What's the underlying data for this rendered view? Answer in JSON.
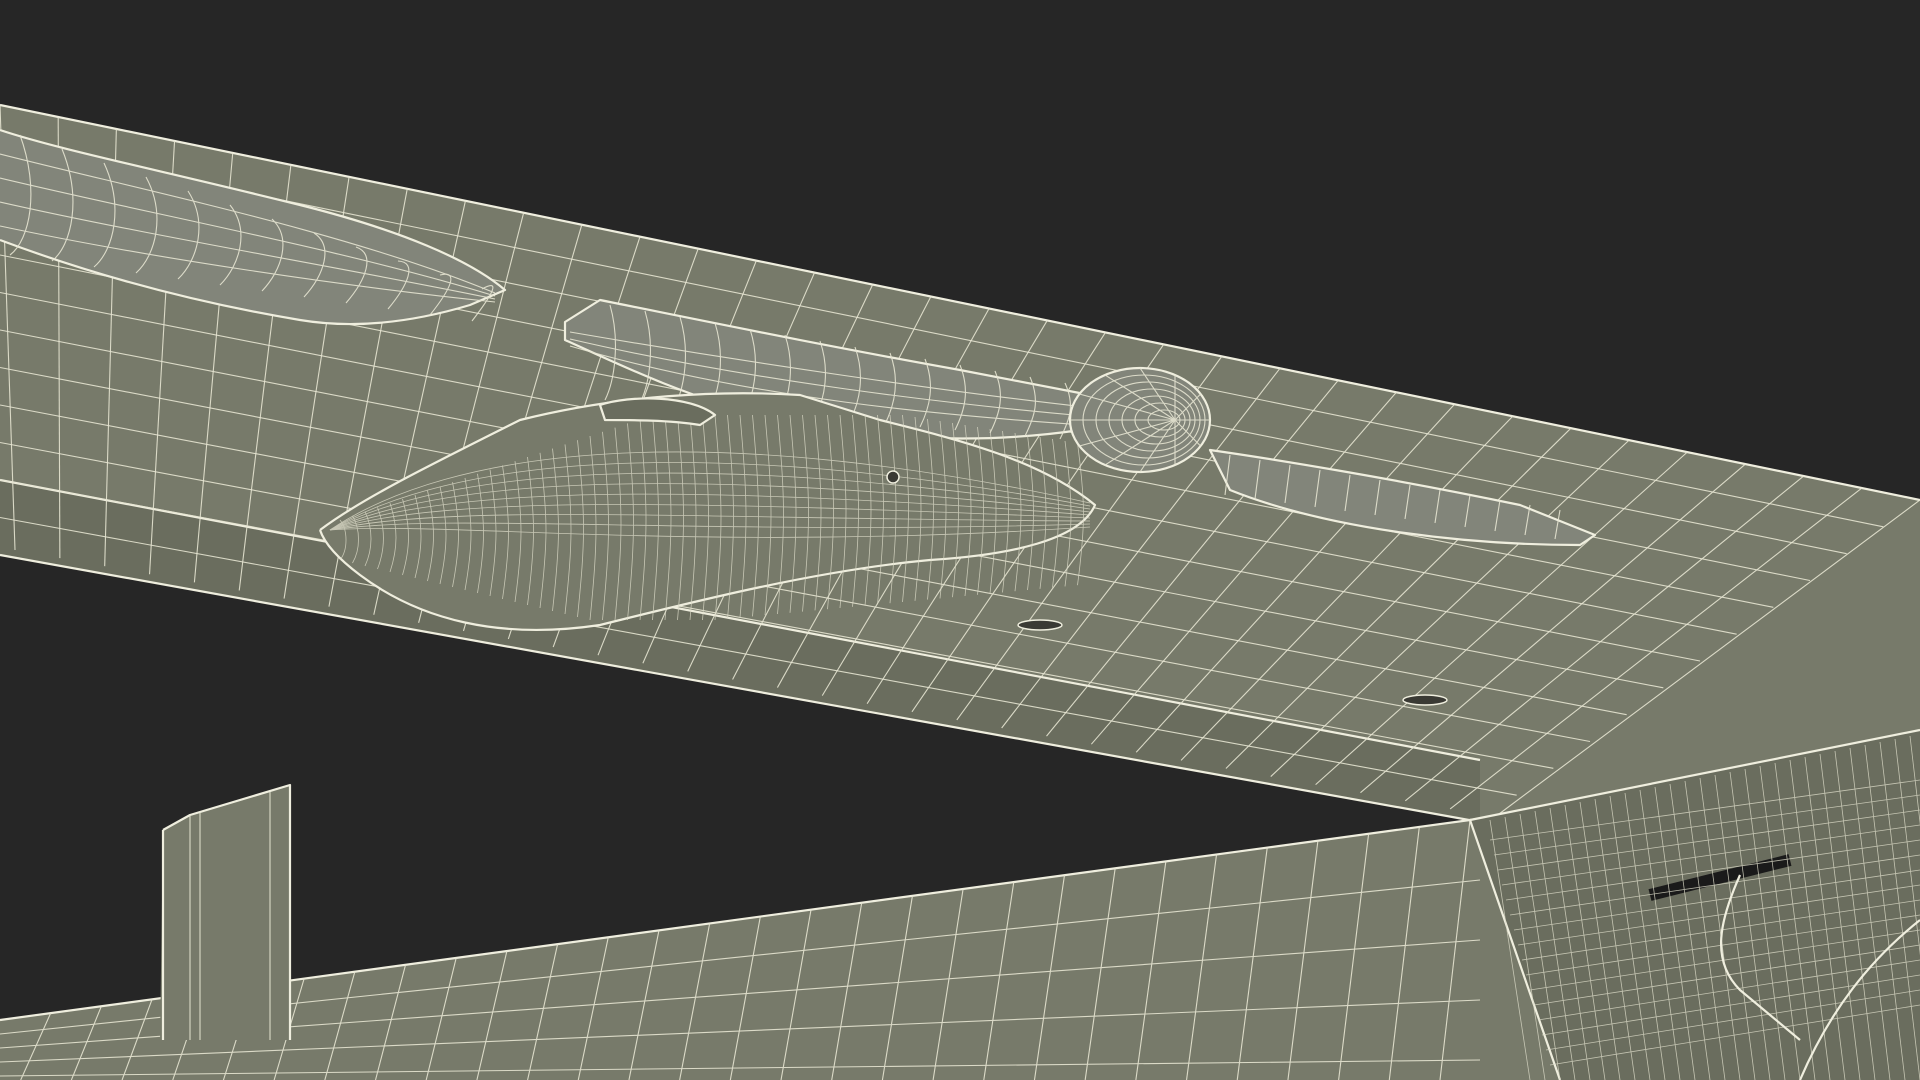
{
  "scene": {
    "background_color": "#262626",
    "mesh_fill_color": "#777a6a",
    "wire_color": "#efeede",
    "subject": "wireframe-aircraft-wing-underside"
  }
}
